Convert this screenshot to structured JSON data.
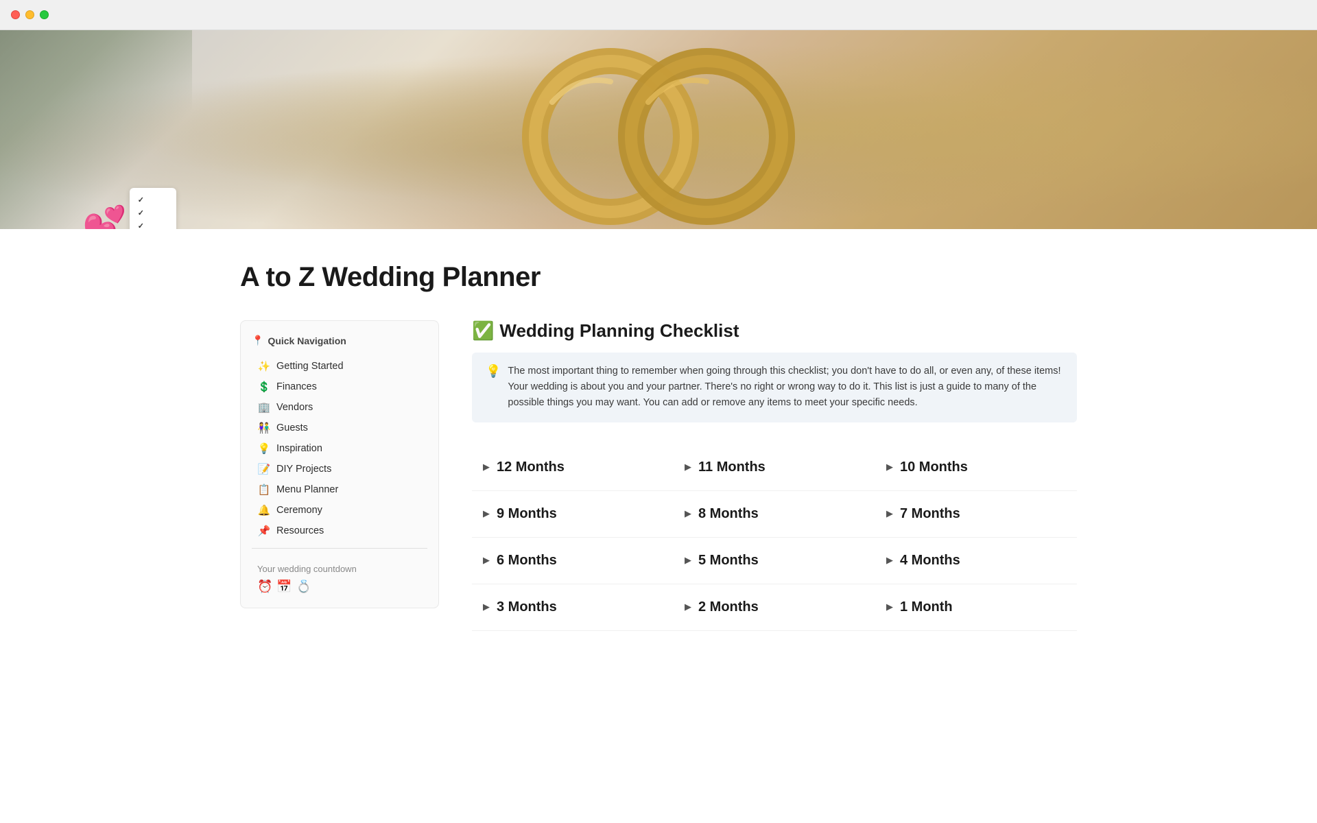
{
  "titlebar": {
    "traffic_lights": [
      "red",
      "yellow",
      "green"
    ]
  },
  "page": {
    "title": "A to Z Wedding Planner"
  },
  "sidebar": {
    "nav_title": "Quick Navigation",
    "nav_icon": "📍",
    "items": [
      {
        "id": "getting-started",
        "emoji": "✨",
        "label": "Getting Started"
      },
      {
        "id": "finances",
        "emoji": "💲",
        "label": "Finances"
      },
      {
        "id": "vendors",
        "emoji": "🏢",
        "label": "Vendors"
      },
      {
        "id": "guests",
        "emoji": "👫",
        "label": "Guests"
      },
      {
        "id": "inspiration",
        "emoji": "💡",
        "label": "Inspiration"
      },
      {
        "id": "diy-projects",
        "emoji": "📝",
        "label": "DIY Projects"
      },
      {
        "id": "menu-planner",
        "emoji": "📋",
        "label": "Menu Planner"
      },
      {
        "id": "ceremony",
        "emoji": "🔔",
        "label": "Ceremony"
      },
      {
        "id": "resources",
        "emoji": "📌",
        "label": "Resources"
      }
    ],
    "countdown_label": "Your wedding countdown"
  },
  "checklist": {
    "heading_emoji": "✅",
    "heading_text": "Wedding Planning Checklist",
    "info_icon": "💡",
    "info_text": "The most important thing to remember when going through this checklist; you don't have to do all, or even any, of these items! Your wedding is about you and your partner. There's no right or wrong way to do it. This list is just a guide to many of the possible things you may want. You can add or remove any items to meet your specific needs.",
    "months": [
      {
        "id": "12-months",
        "label": "12 Months"
      },
      {
        "id": "11-months",
        "label": "11 Months"
      },
      {
        "id": "10-months",
        "label": "10 Months"
      },
      {
        "id": "9-months",
        "label": "9 Months"
      },
      {
        "id": "8-months",
        "label": "8 Months"
      },
      {
        "id": "7-months",
        "label": "7 Months"
      },
      {
        "id": "6-months",
        "label": "6 Months"
      },
      {
        "id": "5-months",
        "label": "5 Months"
      },
      {
        "id": "4-months",
        "label": "4 Months"
      },
      {
        "id": "3-months",
        "label": "3 Months"
      },
      {
        "id": "2-months",
        "label": "2 Months"
      },
      {
        "id": "1-month",
        "label": "1 Month"
      }
    ]
  }
}
